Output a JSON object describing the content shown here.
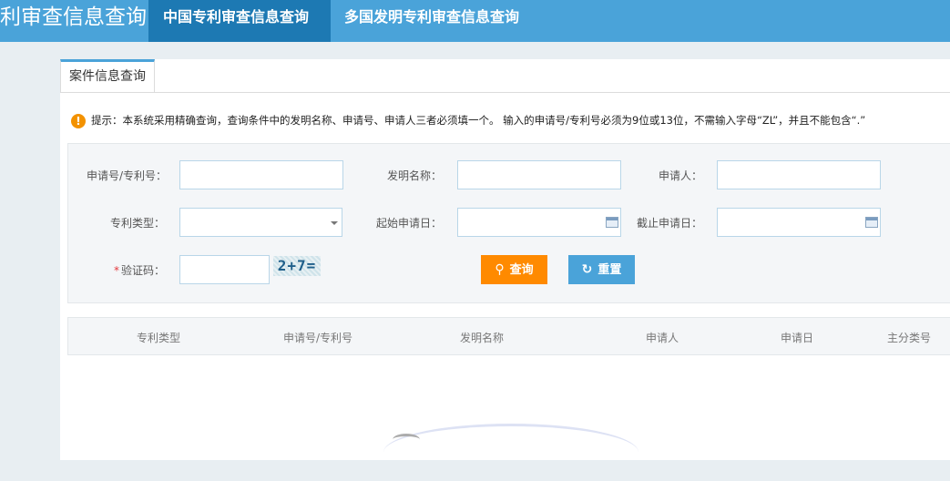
{
  "header": {
    "title": "利审查信息查询",
    "tabs": [
      {
        "label": "中国专利审查信息查询",
        "active": true
      },
      {
        "label": "多国发明专利审查信息查询",
        "active": false
      }
    ]
  },
  "main": {
    "tab_label": "案件信息查询",
    "tip": "提示：本系统采用精确查询，查询条件中的发明名称、申请号、申请人三者必须填一个。 输入的申请号/专利号必须为9位或13位，不需输入字母“ZL”，并且不能包含“.”",
    "form": {
      "application_no_label": "申请号/专利号：",
      "invention_name_label": "发明名称：",
      "applicant_label": "申请人：",
      "patent_type_label": "专利类型：",
      "start_date_label": "起始申请日：",
      "end_date_label": "截止申请日：",
      "captcha_required_mark": "*",
      "captcha_label": "验证码：",
      "captcha_image_text": "2+7=",
      "application_no_value": "",
      "invention_name_value": "",
      "applicant_value": "",
      "patent_type_value": "",
      "start_date_value": "",
      "end_date_value": "",
      "captcha_value": "",
      "search_button": "查询",
      "reset_button": "重置"
    },
    "table": {
      "columns": [
        "专利类型",
        "申请号/专利号",
        "发明名称",
        "申请人",
        "申请日",
        "主分类号"
      ]
    }
  },
  "colors": {
    "header_bg": "#4aa3d9",
    "active_tab_bg": "#1d79b3",
    "search_button": "#ff8a00",
    "reset_button": "#4aa3d9",
    "tip_icon": "#f39200",
    "required_mark": "#e4393c"
  },
  "icons": {
    "tip": "exclamation-circle-icon",
    "search": "magnifier-icon",
    "reset": "refresh-icon",
    "select": "caret-down-icon",
    "date": "calendar-icon"
  }
}
